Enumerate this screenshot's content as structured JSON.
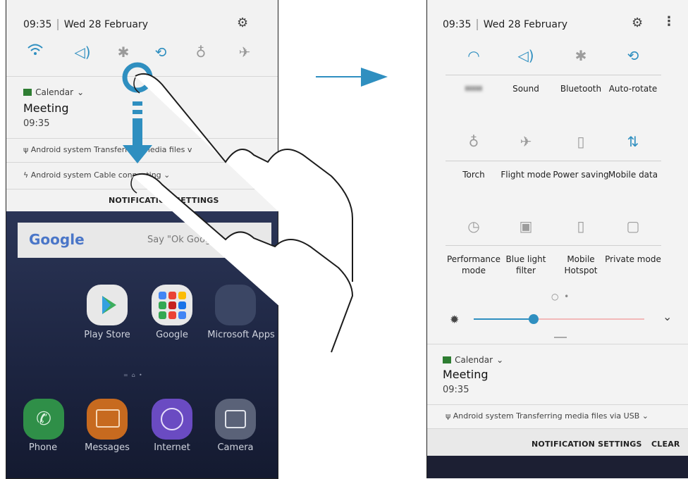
{
  "left": {
    "status": {
      "time": "09:35",
      "date": "Wed 28 February"
    },
    "notification": {
      "app": "Calendar",
      "title": "Meeting",
      "time": "09:35"
    },
    "row1": {
      "source": "Android system",
      "text": "Transferring media files v"
    },
    "row2": {
      "source": "Android system",
      "text": "Cable connecting"
    },
    "settings_label": "NOTIFICATION SETTINGS",
    "google": {
      "logo": "Google",
      "hint": "Say \"Ok Google\""
    },
    "apps_row1": [
      "Play Store",
      "Google",
      "Microsoft Apps"
    ],
    "apps_row2": [
      "Phone",
      "Messages",
      "Internet",
      "Camera"
    ],
    "icons": [
      "wifi-icon",
      "sound-icon",
      "bluetooth-icon",
      "auto-rotate-icon",
      "torch-icon",
      "flight-icon"
    ]
  },
  "right": {
    "status": {
      "time": "09:35",
      "date": "Wed 28 February"
    },
    "tiles": [
      {
        "icon": "wifi-icon",
        "label": "",
        "on": true
      },
      {
        "icon": "sound-icon",
        "label": "Sound",
        "on": true
      },
      {
        "icon": "bluetooth-icon",
        "label": "Bluetooth",
        "on": false
      },
      {
        "icon": "auto-rotate-icon",
        "label": "Auto-rotate",
        "on": true
      },
      {
        "icon": "torch-icon",
        "label": "Torch",
        "on": false
      },
      {
        "icon": "flight-icon",
        "label": "Flight mode",
        "on": false
      },
      {
        "icon": "power-saving-icon",
        "label": "Power saving",
        "on": false
      },
      {
        "icon": "mobile-data-icon",
        "label": "Mobile data",
        "on": true
      },
      {
        "icon": "performance-icon",
        "label": "Performance mode",
        "on": false
      },
      {
        "icon": "blue-light-icon",
        "label": "Blue light filter",
        "on": false
      },
      {
        "icon": "hotspot-icon",
        "label": "Mobile Hotspot",
        "on": false
      },
      {
        "icon": "private-mode-icon",
        "label": "Private mode",
        "on": false
      }
    ],
    "brightness": 0.35,
    "notification": {
      "app": "Calendar",
      "title": "Meeting",
      "time": "09:35"
    },
    "usb_row": {
      "source": "Android system",
      "text": "Transferring media files via USB"
    },
    "settings_label": "NOTIFICATION SETTINGS",
    "clear_label": "CLEAR",
    "colors": {
      "accent": "#2f8fc0",
      "calendar": "#2e7d32"
    }
  }
}
